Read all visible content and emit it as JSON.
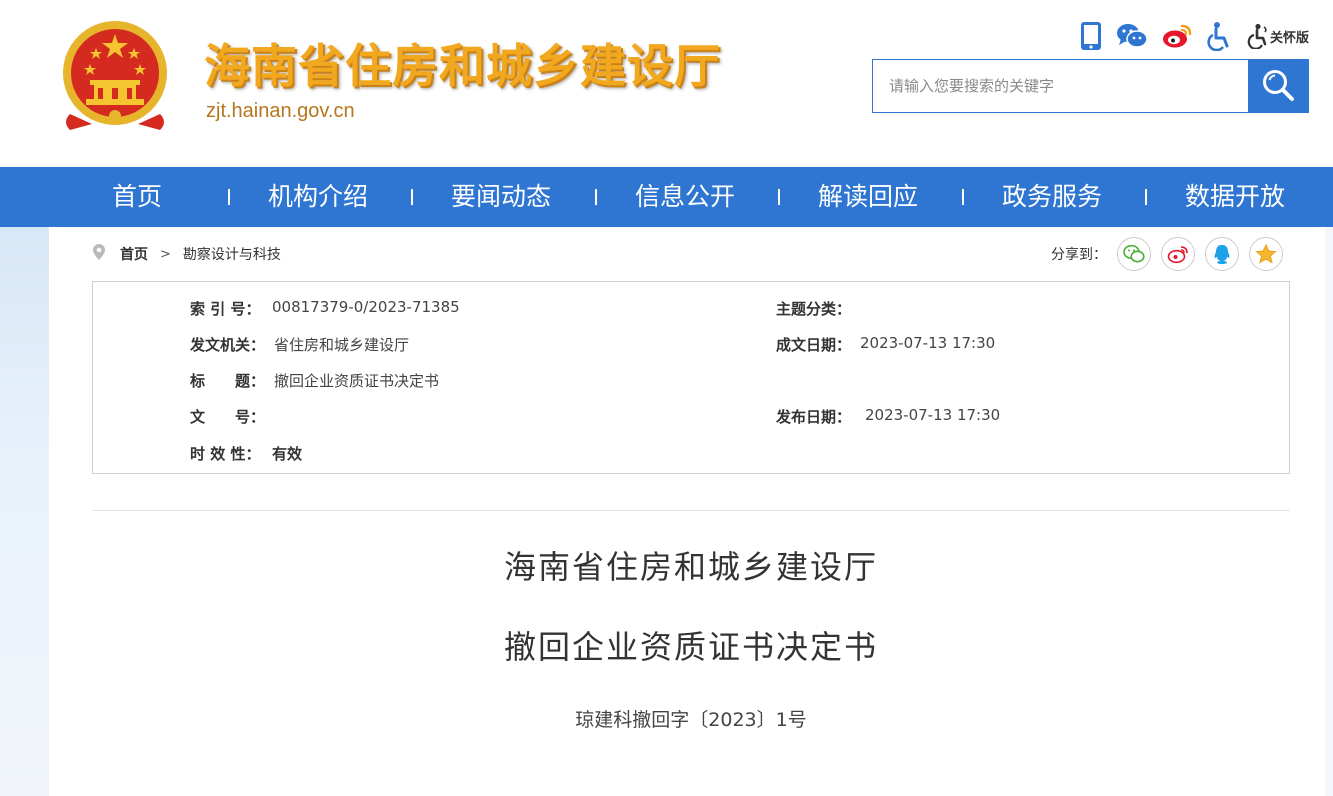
{
  "header": {
    "site_title": "海南省住房和城乡建设厅",
    "site_domain": "zjt.hainan.gov.cn",
    "care_mode_label": "关怀版",
    "search": {
      "placeholder": "请输入您要搜索的关键字",
      "value": ""
    }
  },
  "nav": {
    "items": [
      "首页",
      "机构介绍",
      "要闻动态",
      "信息公开",
      "解读回应",
      "政务服务",
      "数据开放"
    ]
  },
  "breadcrumb": {
    "home": "首页",
    "separator": ">",
    "current": "勘察设计与科技"
  },
  "share": {
    "label": "分享到："
  },
  "info": {
    "index_label": "索 引 号：",
    "index_value": "00817379-0/2023-71385",
    "topic_label": "主题分类：",
    "topic_value": "",
    "issuer_label": "发文机关：",
    "issuer_value": "省住房和城乡建设厅",
    "created_label": "成文日期：",
    "created_value": "2023-07-13 17:30",
    "title_label": "标　　题：",
    "title_value": "撤回企业资质证书决定书",
    "docno_label": "文　　号：",
    "docno_value": "",
    "published_label": "发布日期：",
    "published_value": "2023-07-13 17:30",
    "validity_label": "时 效 性：",
    "validity_value": "有效"
  },
  "document": {
    "title_line_1": "海南省住房和城乡建设厅",
    "title_line_2": "撤回企业资质证书决定书",
    "doc_number": "琼建科撤回字〔2023〕1号"
  },
  "colors": {
    "brand_blue": "#2f76d2",
    "title_gold": "#f2a81e",
    "domain_brown": "#b5761e",
    "emblem_red": "#d42a20"
  },
  "icons": [
    "mobile-icon",
    "wechat-icon",
    "weibo-icon",
    "accessibility-icon",
    "care-mode-icon",
    "search-icon",
    "location-pin-icon",
    "share-wechat-icon",
    "share-weibo-icon",
    "share-qq-icon",
    "share-favorite-icon"
  ]
}
